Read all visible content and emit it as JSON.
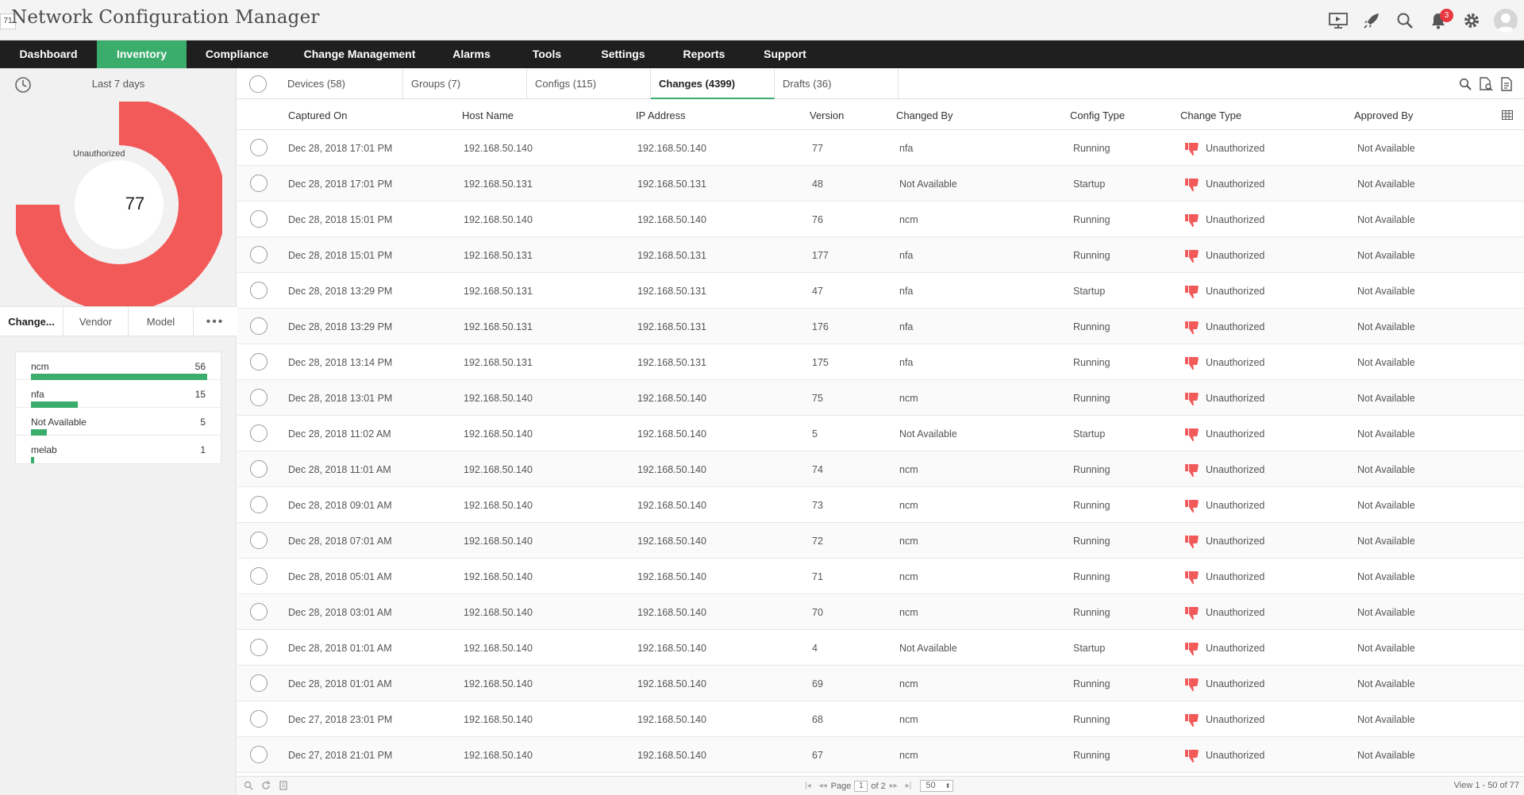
{
  "app": {
    "badge": "71",
    "title": "Network Configuration Manager",
    "notification_count": "3"
  },
  "nav": [
    {
      "label": "Dashboard",
      "active": false
    },
    {
      "label": "Inventory",
      "active": true
    },
    {
      "label": "Compliance",
      "active": false
    },
    {
      "label": "Change Management",
      "active": false
    },
    {
      "label": "Alarms",
      "active": false
    },
    {
      "label": "Tools",
      "active": false
    },
    {
      "label": "Settings",
      "active": false
    },
    {
      "label": "Reports",
      "active": false
    },
    {
      "label": "Support",
      "active": false
    }
  ],
  "sidebar": {
    "period": "Last 7 days",
    "donut": {
      "value": "77",
      "legend": "Unauthorized",
      "color": "#f25a5a",
      "fraction": 0.75
    },
    "subtabs": [
      "Change...",
      "Vendor",
      "Model"
    ],
    "bars": [
      {
        "name": "ncm",
        "count": "56",
        "value": 56
      },
      {
        "name": "nfa",
        "count": "15",
        "value": 15
      },
      {
        "name": "Not Available",
        "count": "5",
        "value": 5
      },
      {
        "name": "melab",
        "count": "1",
        "value": 1
      }
    ],
    "bar_color": "#3aac6c"
  },
  "tabs": [
    {
      "label": "Devices (58)",
      "active": false
    },
    {
      "label": "Groups (7)",
      "active": false
    },
    {
      "label": "Configs (115)",
      "active": false
    },
    {
      "label": "Changes (4399)",
      "active": true
    },
    {
      "label": "Drafts (36)",
      "active": false
    }
  ],
  "table": {
    "columns": [
      "Captured On",
      "Host Name",
      "IP Address",
      "Version",
      "Changed By",
      "Config Type",
      "Change Type",
      "Approved By"
    ],
    "rows": [
      [
        "Dec 28, 2018 17:01 PM",
        "192.168.50.140",
        "192.168.50.140",
        "77",
        "nfa",
        "Running",
        "Unauthorized",
        "Not Available"
      ],
      [
        "Dec 28, 2018 17:01 PM",
        "192.168.50.131",
        "192.168.50.131",
        "48",
        "Not Available",
        "Startup",
        "Unauthorized",
        "Not Available"
      ],
      [
        "Dec 28, 2018 15:01 PM",
        "192.168.50.140",
        "192.168.50.140",
        "76",
        "ncm",
        "Running",
        "Unauthorized",
        "Not Available"
      ],
      [
        "Dec 28, 2018 15:01 PM",
        "192.168.50.131",
        "192.168.50.131",
        "177",
        "nfa",
        "Running",
        "Unauthorized",
        "Not Available"
      ],
      [
        "Dec 28, 2018 13:29 PM",
        "192.168.50.131",
        "192.168.50.131",
        "47",
        "nfa",
        "Startup",
        "Unauthorized",
        "Not Available"
      ],
      [
        "Dec 28, 2018 13:29 PM",
        "192.168.50.131",
        "192.168.50.131",
        "176",
        "nfa",
        "Running",
        "Unauthorized",
        "Not Available"
      ],
      [
        "Dec 28, 2018 13:14 PM",
        "192.168.50.131",
        "192.168.50.131",
        "175",
        "nfa",
        "Running",
        "Unauthorized",
        "Not Available"
      ],
      [
        "Dec 28, 2018 13:01 PM",
        "192.168.50.140",
        "192.168.50.140",
        "75",
        "ncm",
        "Running",
        "Unauthorized",
        "Not Available"
      ],
      [
        "Dec 28, 2018 11:02 AM",
        "192.168.50.140",
        "192.168.50.140",
        "5",
        "Not Available",
        "Startup",
        "Unauthorized",
        "Not Available"
      ],
      [
        "Dec 28, 2018 11:01 AM",
        "192.168.50.140",
        "192.168.50.140",
        "74",
        "ncm",
        "Running",
        "Unauthorized",
        "Not Available"
      ],
      [
        "Dec 28, 2018 09:01 AM",
        "192.168.50.140",
        "192.168.50.140",
        "73",
        "ncm",
        "Running",
        "Unauthorized",
        "Not Available"
      ],
      [
        "Dec 28, 2018 07:01 AM",
        "192.168.50.140",
        "192.168.50.140",
        "72",
        "ncm",
        "Running",
        "Unauthorized",
        "Not Available"
      ],
      [
        "Dec 28, 2018 05:01 AM",
        "192.168.50.140",
        "192.168.50.140",
        "71",
        "ncm",
        "Running",
        "Unauthorized",
        "Not Available"
      ],
      [
        "Dec 28, 2018 03:01 AM",
        "192.168.50.140",
        "192.168.50.140",
        "70",
        "ncm",
        "Running",
        "Unauthorized",
        "Not Available"
      ],
      [
        "Dec 28, 2018 01:01 AM",
        "192.168.50.140",
        "192.168.50.140",
        "4",
        "Not Available",
        "Startup",
        "Unauthorized",
        "Not Available"
      ],
      [
        "Dec 28, 2018 01:01 AM",
        "192.168.50.140",
        "192.168.50.140",
        "69",
        "ncm",
        "Running",
        "Unauthorized",
        "Not Available"
      ],
      [
        "Dec 27, 2018 23:01 PM",
        "192.168.50.140",
        "192.168.50.140",
        "68",
        "ncm",
        "Running",
        "Unauthorized",
        "Not Available"
      ],
      [
        "Dec 27, 2018 21:01 PM",
        "192.168.50.140",
        "192.168.50.140",
        "67",
        "ncm",
        "Running",
        "Unauthorized",
        "Not Available"
      ]
    ],
    "change_icon": "thumbs-down-icon",
    "change_icon_color": "#f25a5a"
  },
  "footer": {
    "page_label": "Page",
    "page_value": "1",
    "of_label": "of 2",
    "page_size": "50",
    "view_count": "View 1 - 50 of 77"
  }
}
